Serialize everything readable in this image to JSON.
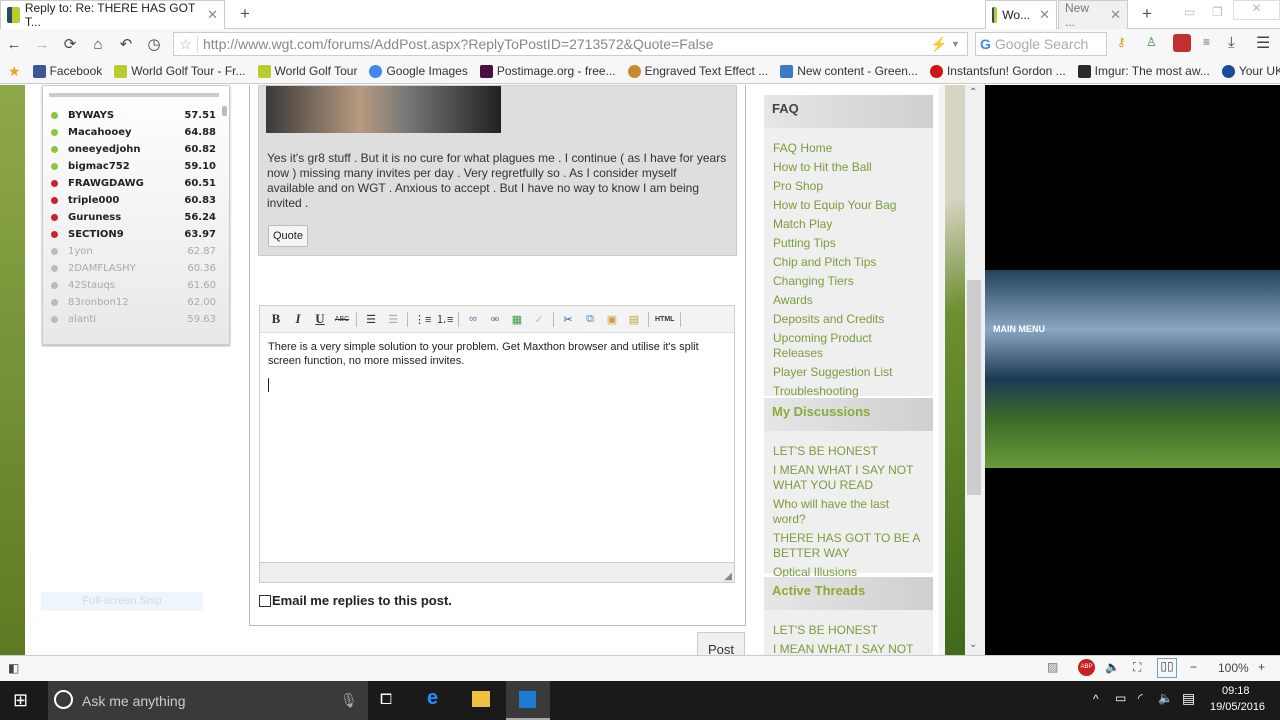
{
  "browser": {
    "tabs": [
      {
        "title": "Reply to: Re: THERE HAS GOT T...",
        "active": true
      },
      {
        "title": "Wo...",
        "active": false
      },
      {
        "title": "New ...",
        "active": false
      }
    ],
    "new_tab": "+",
    "url": "http://www.wgt.com/forums/AddPost.aspx?ReplyToPostID=2713572&Quote=False",
    "search_placeholder": "Google Search",
    "bookmarks": [
      {
        "label": "Facebook",
        "color": "#3b5998"
      },
      {
        "label": "World Golf Tour - Fr...",
        "color": "#b8cc30"
      },
      {
        "label": "World Golf Tour",
        "color": "#b8cc30"
      },
      {
        "label": "Google Images",
        "color": "#4285f4"
      },
      {
        "label": "Postimage.org - free...",
        "color": "#4a1040"
      },
      {
        "label": "Engraved Text Effect ...",
        "color": "#c88a30"
      },
      {
        "label": "New content - Green...",
        "color": "#3a7ac8"
      },
      {
        "label": "Instantsfun! Gordon ...",
        "color": "#c81818"
      },
      {
        "label": "Imgur: The most aw...",
        "color": "#2b2b2b"
      },
      {
        "label": "Your UK Tr",
        "color": "#1a4a9a"
      }
    ],
    "zoom": "100%"
  },
  "leaderboard": [
    {
      "name": "BYWAYS",
      "score": "57.51",
      "status": "online"
    },
    {
      "name": "Macahooey",
      "score": "64.88",
      "status": "online"
    },
    {
      "name": "oneeyedjohn",
      "score": "60.82",
      "status": "online"
    },
    {
      "name": "bigmac752",
      "score": "59.10",
      "status": "online"
    },
    {
      "name": "FRAWGDAWG",
      "score": "60.51",
      "status": "busy"
    },
    {
      "name": "triple000",
      "score": "60.83",
      "status": "busy"
    },
    {
      "name": "Guruness",
      "score": "56.24",
      "status": "busy"
    },
    {
      "name": "SECTION9",
      "score": "63.97",
      "status": "busy"
    },
    {
      "name": "1yon",
      "score": "62.87",
      "status": "offline"
    },
    {
      "name": "2DAMFLASHY",
      "score": "60.36",
      "status": "offline"
    },
    {
      "name": "42Stauqs",
      "score": "61.60",
      "status": "offline"
    },
    {
      "name": "83ronbon12",
      "score": "62.00",
      "status": "offline"
    },
    {
      "name": "alanti",
      "score": "59.63",
      "status": "offline"
    }
  ],
  "status_colors": {
    "online": "#8cc63f",
    "busy": "#d0202a",
    "offline": "#bbbbbb"
  },
  "snip_label": "Full-screen Snip",
  "post": {
    "text": "Yes it's gr8 stuff . But it is no cure for what plagues me . I continue ( as I have for years now ) missing many invites per day . Very regretfully so . As I consider myself available and on WGT . Anxious to accept . But I have no way to know I am being invited .",
    "quote_label": "Quote"
  },
  "editor": {
    "toolbar": [
      "bold",
      "italic",
      "underline",
      "strikethrough",
      "indent",
      "outdent",
      "bullet-list",
      "numbered-list",
      "link",
      "unlink",
      "insert-image",
      "spellcheck",
      "cut",
      "copy",
      "paste",
      "paste-word",
      "html"
    ],
    "bold": "B",
    "italic": "I",
    "underline": "U",
    "strike": "ABC",
    "html": "HTML",
    "content": "There is a very simple solution to your problem. Get Maxthon browser and utilise it's split screen function, no more missed invites."
  },
  "email_label": "Email me replies to this post.",
  "post_button": "Post",
  "sidebar": {
    "faq": {
      "title": "FAQ",
      "links": [
        "FAQ Home",
        "How to Hit the Ball",
        "Pro Shop",
        "How to Equip Your Bag",
        "Match Play",
        "Putting Tips",
        "Chip and Pitch Tips",
        "Changing Tiers",
        "Awards",
        "Deposits and Credits",
        "Upcoming Product Releases",
        "Player Suggestion List",
        "Troubleshooting"
      ]
    },
    "discussions": {
      "title": "My Discussions",
      "links": [
        "LET'S BE HONEST",
        "I MEAN WHAT I SAY NOT WHAT YOU READ",
        "Who will have the last word?",
        "THERE HAS GOT TO BE A BETTER WAY",
        "Optical Illusions"
      ]
    },
    "threads": {
      "title": "Active Threads",
      "links": [
        "LET'S BE HONEST",
        "I MEAN WHAT I SAY NOT"
      ]
    }
  },
  "game_preview": {
    "title": "MAIN MENU"
  },
  "link_color": "#7c9c3c",
  "taskbar": {
    "search": "Ask me anything",
    "time": "09:18",
    "date": "19/05/2016"
  }
}
